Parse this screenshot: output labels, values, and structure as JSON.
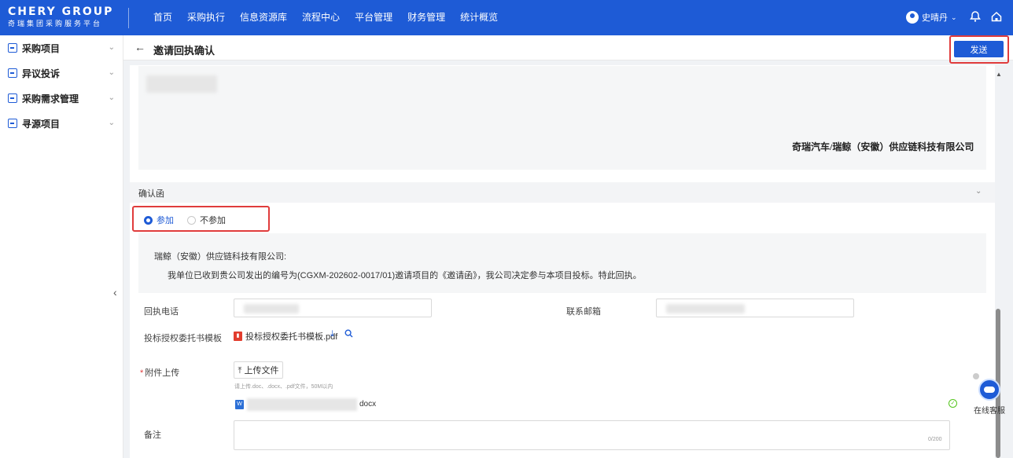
{
  "app": {
    "logo_main": "CHERY GROUP",
    "logo_sub": "奇瑞集团采购服务平台"
  },
  "nav": [
    "首页",
    "采购执行",
    "信息资源库",
    "流程中心",
    "平台管理",
    "财务管理",
    "统计概览"
  ],
  "user": {
    "name": "史晴丹"
  },
  "sidebar": {
    "items": [
      {
        "label": "采购项目"
      },
      {
        "label": "异议投诉"
      },
      {
        "label": "采购需求管理"
      },
      {
        "label": "寻源项目"
      }
    ]
  },
  "header": {
    "title": "邀请回执确认",
    "send_label": "发送"
  },
  "letter": {
    "company": "奇瑞汽车/瑞鲸（安徽）供应链科技有限公司"
  },
  "confirm": {
    "section_title": "确认函",
    "options": [
      "参加",
      "不参加"
    ],
    "selected": "参加",
    "addressee": "瑞鲸（安徽）供应链科技有限公司:",
    "body": "我单位已收到贵公司发出的编号为(CGXM-202602-0017/01)邀请项目的《邀请函》，我公司决定参与本项目投标。特此回执。"
  },
  "form": {
    "phone_label": "回执电话",
    "email_label": "联系邮箱",
    "template_label": "投标授权委托书模板",
    "template_file": "投标授权委托书模板.pdf",
    "attach_label": "附件上传",
    "upload_label": "上传文件",
    "upload_tip": "请上传.doc、.docx、.pdf文件，50M以内",
    "uploaded_ext": "docx",
    "remark_label": "备注",
    "remark_counter": "0/200"
  },
  "support": {
    "label": "在线客服"
  },
  "colors": {
    "primary": "#1e5bd6",
    "highlight": "#e03c3c"
  }
}
